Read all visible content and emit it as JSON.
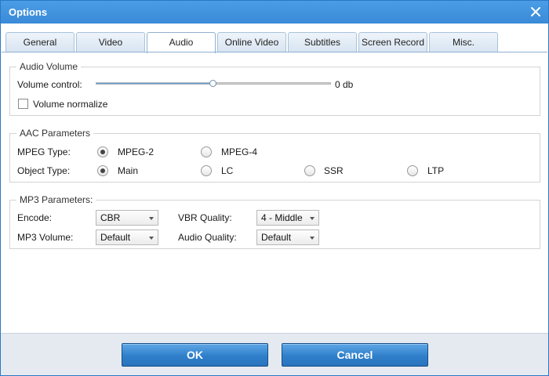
{
  "window": {
    "title": "Options"
  },
  "tabs": [
    {
      "label": "General"
    },
    {
      "label": "Video"
    },
    {
      "label": "Audio",
      "active": true
    },
    {
      "label": "Online Video"
    },
    {
      "label": "Subtitles"
    },
    {
      "label": "Screen Record"
    },
    {
      "label": "Misc."
    }
  ],
  "audio_volume": {
    "legend": "Audio Volume",
    "volume_label": "Volume control:",
    "volume_value_text": "0 db",
    "volume_level": 0.5,
    "normalize_label": "Volume normalize",
    "normalize_checked": false
  },
  "aac": {
    "legend": "AAC Parameters",
    "mpeg_type_label": "MPEG Type:",
    "mpeg_options": [
      {
        "label": "MPEG-2",
        "checked": true
      },
      {
        "label": "MPEG-4",
        "checked": false
      }
    ],
    "object_type_label": "Object Type:",
    "object_options": [
      {
        "label": "Main",
        "checked": true
      },
      {
        "label": "LC",
        "checked": false
      },
      {
        "label": "SSR",
        "checked": false
      },
      {
        "label": "LTP",
        "checked": false
      }
    ]
  },
  "mp3": {
    "legend": "MP3 Parameters:",
    "encode_label": "Encode:",
    "encode_value": "CBR",
    "vbr_quality_label": "VBR Quality:",
    "vbr_quality_value": "4 - Middle",
    "mp3_volume_label": "MP3 Volume:",
    "mp3_volume_value": "Default",
    "audio_quality_label": "Audio Quality:",
    "audio_quality_value": "Default"
  },
  "footer": {
    "ok_label": "OK",
    "cancel_label": "Cancel"
  },
  "colors": {
    "title_bar": "#3a8ad8",
    "button": "#2f7fcb",
    "slider_fill": "#5aa0e0"
  }
}
